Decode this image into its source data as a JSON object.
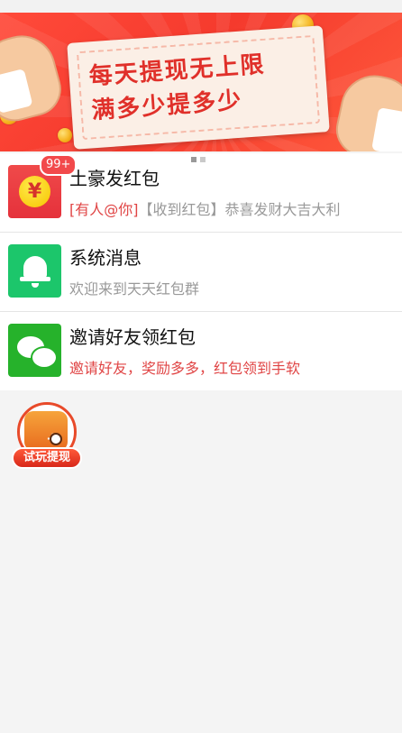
{
  "banner": {
    "line1": "每天提现无上限",
    "line2": "满多少提多少",
    "dots": [
      true,
      false
    ]
  },
  "list": [
    {
      "title": "土豪发红包",
      "badge": "99+",
      "sub_highlight": "[有人@你]",
      "sub_rest": "【收到红包】恭喜发财大吉大利",
      "icon": "red-envelope-yen-icon"
    },
    {
      "title": "系统消息",
      "sub": "欢迎来到天天红包群",
      "icon": "bell-icon"
    },
    {
      "title": "邀请好友领红包",
      "sub": "邀请好友，奖励多多，红包领到手软",
      "icon": "wechat-icon"
    }
  ],
  "game_button": {
    "label": "试玩提现",
    "icon": "game-controller-icon"
  },
  "colors": {
    "banner_red": "#f53a2d",
    "highlight_red": "#e04545",
    "green": "#1cc66b",
    "wechat_green": "#26b22b"
  }
}
